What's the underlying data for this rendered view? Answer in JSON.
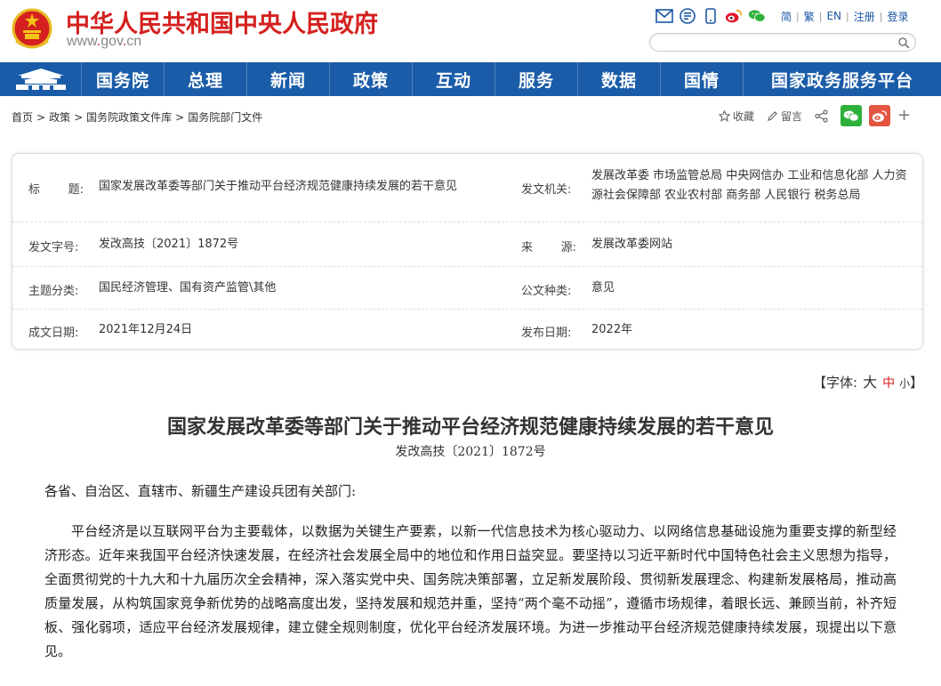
{
  "header": {
    "site_title": "中华人民共和国中央人民政府",
    "site_domain_prefix": "www",
    "site_domain_dot1": ".",
    "site_domain_mid": "gov",
    "site_domain_dot2": ".",
    "site_domain_suffix": "cn",
    "tools": [
      "mail-icon",
      "rss-icon",
      "mobile-icon",
      "weibo-icon",
      "wechat-icon"
    ],
    "links": {
      "simplified": "简",
      "traditional": "繁",
      "english": "EN",
      "register": "注册",
      "login": "登录"
    },
    "search_placeholder": ""
  },
  "nav": {
    "items": [
      "国务院",
      "总理",
      "新闻",
      "政策",
      "互动",
      "服务",
      "数据",
      "国情",
      "国家政务服务平台"
    ]
  },
  "breadcrumb": {
    "items": [
      "首页",
      "政策",
      "国务院政策文件库",
      "国务院部门文件"
    ],
    "separator": ">"
  },
  "actions": {
    "favorite": "收藏",
    "comment": "留言"
  },
  "info": {
    "title_label_a": "标",
    "title_label_b": "题:",
    "title_value": "国家发展改革委等部门关于推动平台经济规范健康持续发展的若干意见",
    "issuer_label": "发文机关:",
    "issuer_value": "发展改革委 市场监管总局 中央网信办 工业和信息化部 人力资源社会保障部 农业农村部 商务部 人民银行 税务总局",
    "docno_label": "发文字号:",
    "docno_value": "发改高技〔2021〕1872号",
    "source_label_a": "来",
    "source_label_b": "源:",
    "source_value": "发展改革委网站",
    "topic_label": "主题分类:",
    "topic_value": "国民经济管理、国有资产监管\\其他",
    "doctype_label": "公文种类:",
    "doctype_value": "意见",
    "created_label": "成文日期:",
    "created_value": "2021年12月24日",
    "published_label": "发布日期:",
    "published_value": "2022年"
  },
  "font_size": {
    "prefix": "【字体:",
    "large": "大",
    "medium": "中",
    "small": "小",
    "suffix": "】"
  },
  "article": {
    "title": "国家发展改革委等部门关于推动平台经济规范健康持续发展的若干意见",
    "docno": "发改高技〔2021〕1872号",
    "address": "各省、自治区、直辖市、新疆生产建设兵团有关部门:",
    "paragraph": "平台经济是以互联网平台为主要载体，以数据为关键生产要素，以新一代信息技术为核心驱动力、以网络信息基础设施为重要支撑的新型经济形态。近年来我国平台经济快速发展，在经济社会发展全局中的地位和作用日益突显。要坚持以习近平新时代中国特色社会主义思想为指导，全面贯彻党的十九大和十九届历次全会精神，深入落实党中央、国务院决策部署，立足新发展阶段、贯彻新发展理念、构建新发展格局，推动高质量发展，从构筑国家竞争新优势的战略高度出发，坚持发展和规范并重，坚持“两个毫不动摇”，遵循市场规律，着眼长远、兼顾当前，补齐短板、强化弱项，适应平台经济发展规律，建立健全规则制度，优化平台经济发展环境。为进一步推动平台经济规范健康持续发展，现提出以下意见。"
  },
  "colors": {
    "brand_red": "#d4211f",
    "nav_blue": "#1a5ca8",
    "link_blue": "#1b56a5"
  }
}
